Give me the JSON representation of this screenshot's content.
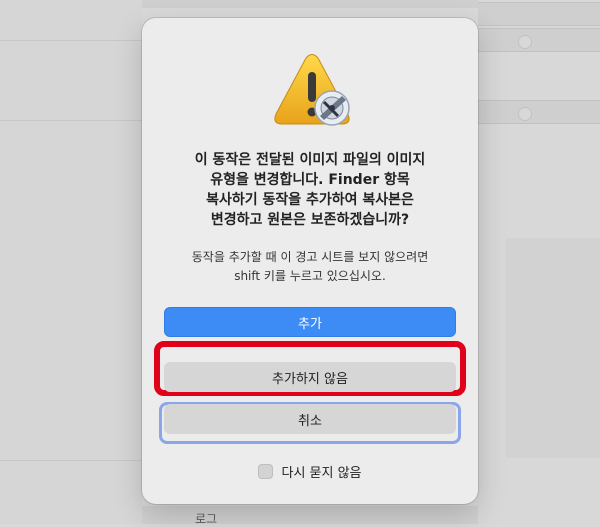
{
  "dialog": {
    "icon": "warning-triangle-automator-icon",
    "title": "이 동작은 전달된 이미지 파일의 이미지\n유형을 변경합니다.  Finder 항목\n복사하기 동작을 추가하여 복사본은\n변경하고 원본은 보존하겠습니까?",
    "info": "동작을 추가할 때 이 경고 시트를 보지 않으려면\nshift 키를 누르고 있으십시오.",
    "buttons": {
      "add": "추가",
      "dont_add": "추가하지 않음",
      "cancel": "취소"
    },
    "checkbox_label": "다시 묻지 않음",
    "checkbox_checked": false
  },
  "background": {
    "bottom_label": "로그"
  },
  "colors": {
    "primary_button": "#3d8cf6",
    "highlight": "#e0001a",
    "focus_ring": "#8aa6e8"
  }
}
